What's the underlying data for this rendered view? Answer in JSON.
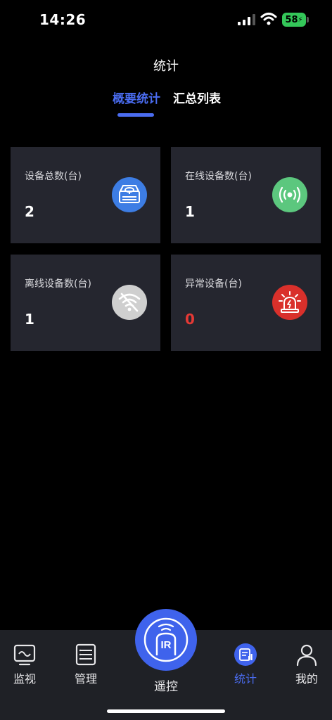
{
  "status_bar": {
    "time": "14:26",
    "battery": "58"
  },
  "header": {
    "title": "统计"
  },
  "tabs": [
    {
      "label": "概要统计",
      "active": true
    },
    {
      "label": "汇总列表",
      "active": false
    }
  ],
  "cards": [
    {
      "label": "设备总数(台)",
      "value": "2",
      "icon": "device-box-icon",
      "icon_color": "#3d7de4"
    },
    {
      "label": "在线设备数(台)",
      "value": "1",
      "icon": "broadcast-signal-icon",
      "icon_color": "#5cc77e"
    },
    {
      "label": "离线设备数(台)",
      "value": "1",
      "icon": "wifi-off-icon",
      "icon_color": "#cfcfcf"
    },
    {
      "label": "异常设备(台)",
      "value": "0",
      "icon": "alarm-light-icon",
      "icon_color": "#d9302b",
      "value_color": "#e53935"
    }
  ],
  "bottom_nav": {
    "items": [
      {
        "label": "监视",
        "icon": "monitor-icon"
      },
      {
        "label": "管理",
        "icon": "list-manage-icon"
      },
      {
        "label": "统计",
        "icon": "stats-doc-icon",
        "active": true
      },
      {
        "label": "我的",
        "icon": "user-icon"
      }
    ],
    "center": {
      "label": "遥控",
      "badge": "IR",
      "icon": "ir-remote-icon"
    }
  },
  "colors": {
    "accent": "#4a6cf0",
    "card_bg": "#25262f",
    "tab_bar_bg": "#1f2126",
    "alert": "#e53935"
  }
}
